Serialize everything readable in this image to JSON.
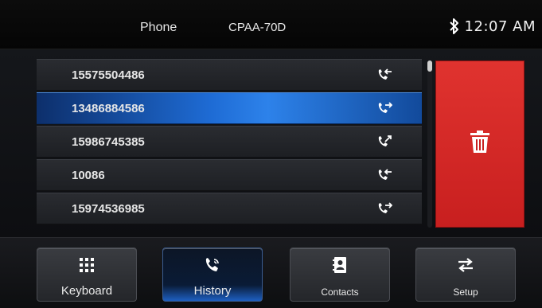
{
  "header": {
    "title": "Phone",
    "device": "CPAA-70D",
    "time": "12:07 AM",
    "bluetooth_icon": "bluetooth-icon"
  },
  "history": {
    "rows": [
      {
        "number": "15575504486",
        "call_type": "incoming",
        "icon": "incoming-call-icon",
        "selected": false
      },
      {
        "number": "13486884586",
        "call_type": "outgoing",
        "icon": "outgoing-call-icon",
        "selected": true
      },
      {
        "number": "15986745385",
        "call_type": "missed",
        "icon": "missed-call-icon",
        "selected": false
      },
      {
        "number": "10086",
        "call_type": "incoming",
        "icon": "incoming-call-icon",
        "selected": false
      },
      {
        "number": "15974536985",
        "call_type": "outgoing",
        "icon": "outgoing-call-icon",
        "selected": false
      }
    ]
  },
  "delete_button": {
    "icon": "trash-icon",
    "color": "#d42a27"
  },
  "tabs": [
    {
      "label": "Keyboard",
      "icon": "keypad-icon",
      "active": false
    },
    {
      "label": "History",
      "icon": "phone-history-icon",
      "active": true
    },
    {
      "label": "Contacts",
      "icon": "contacts-book-icon",
      "active": false
    },
    {
      "label": "Setup",
      "icon": "swap-arrows-icon",
      "active": false
    }
  ],
  "colors": {
    "accent": "#1e6bd4",
    "delete": "#d42a27",
    "background": "#000000"
  }
}
